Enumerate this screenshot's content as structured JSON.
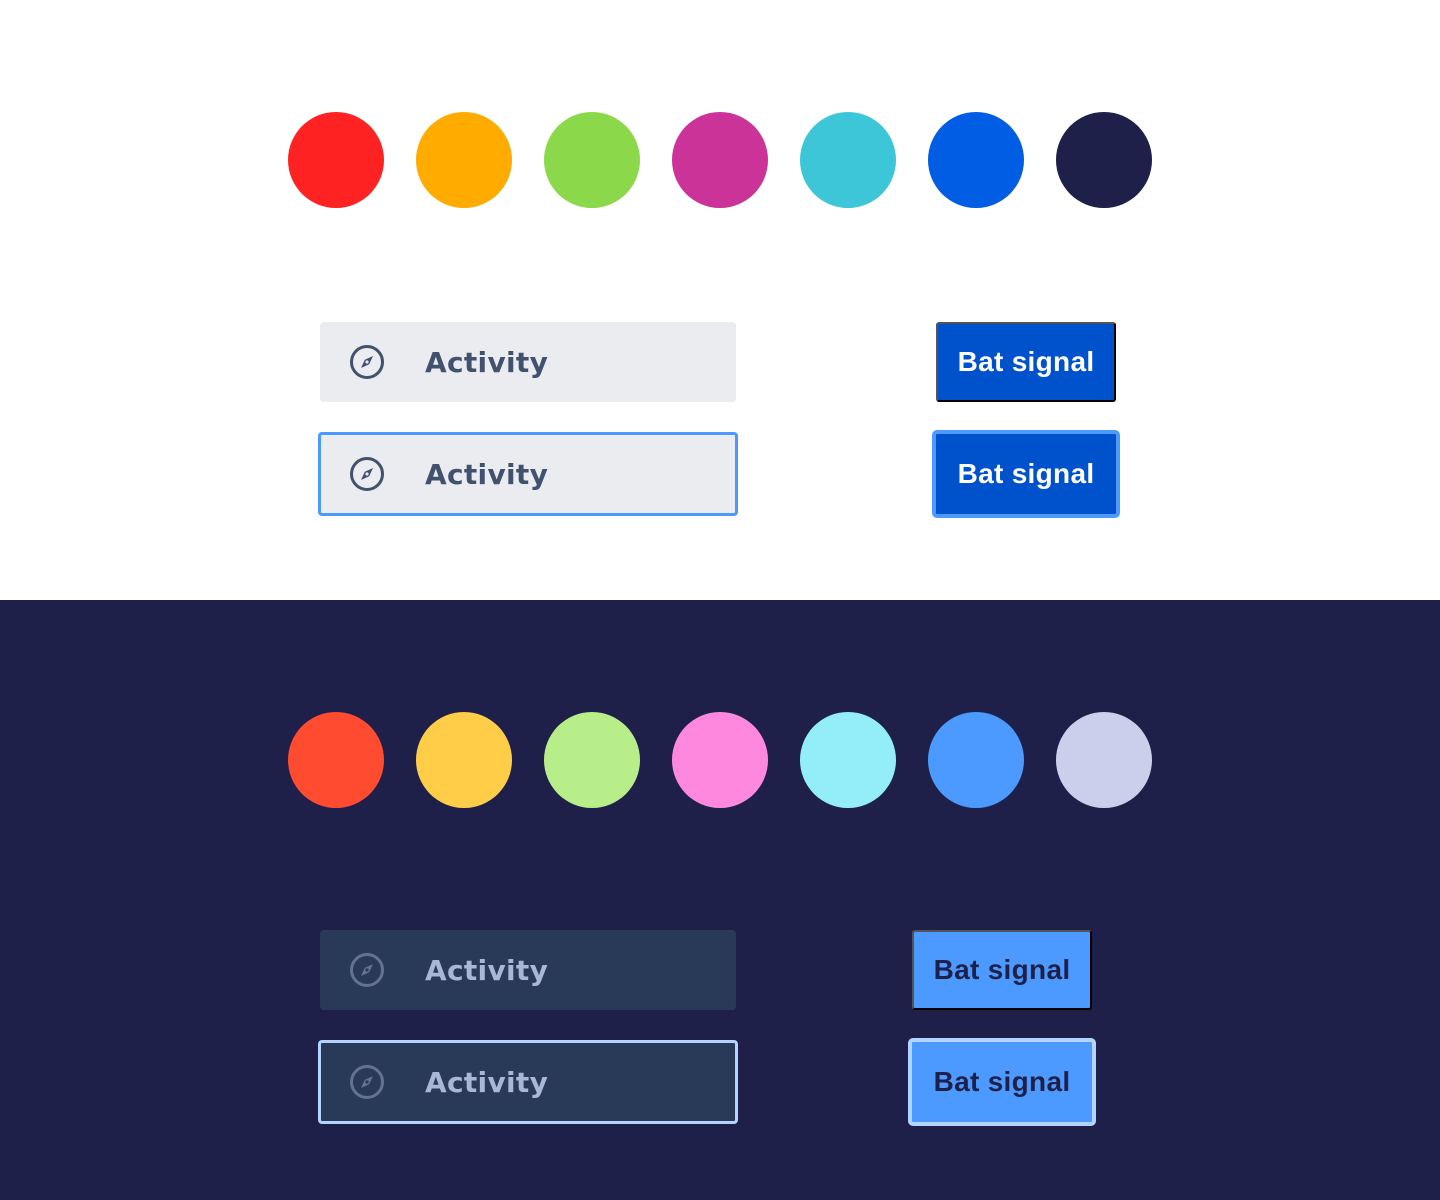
{
  "light": {
    "swatches": [
      "#ff2222",
      "#ffab00",
      "#8bd84a",
      "#cc3399",
      "#3cc6d8",
      "#005de4",
      "#1e204a"
    ],
    "field_label": "Activity",
    "field_focused_label": "Activity",
    "field_icon": "compass-icon",
    "button_label": "Bat signal",
    "button_focused_label": "Bat signal",
    "colors": {
      "field_bg": "#ebecf0",
      "field_text": "#42526e",
      "focus_ring": "#4c9aff",
      "button_bg": "#0052cc",
      "button_text": "#ffffff"
    }
  },
  "dark": {
    "swatches": [
      "#ff4b2f",
      "#ffcd47",
      "#b7ee8a",
      "#ff88df",
      "#93eef9",
      "#4c9aff",
      "#cccfeb"
    ],
    "field_label": "Activity",
    "field_focused_label": "Activity",
    "field_icon": "compass-icon",
    "button_label": "Bat signal",
    "button_focused_label": "Bat signal",
    "colors": {
      "background": "#1e204a",
      "field_bg": "#283a58",
      "field_text": "#a8b7d4",
      "focus_ring": "#b3d4ff",
      "button_bg": "#4c9aff",
      "button_text": "#1e204a"
    }
  }
}
